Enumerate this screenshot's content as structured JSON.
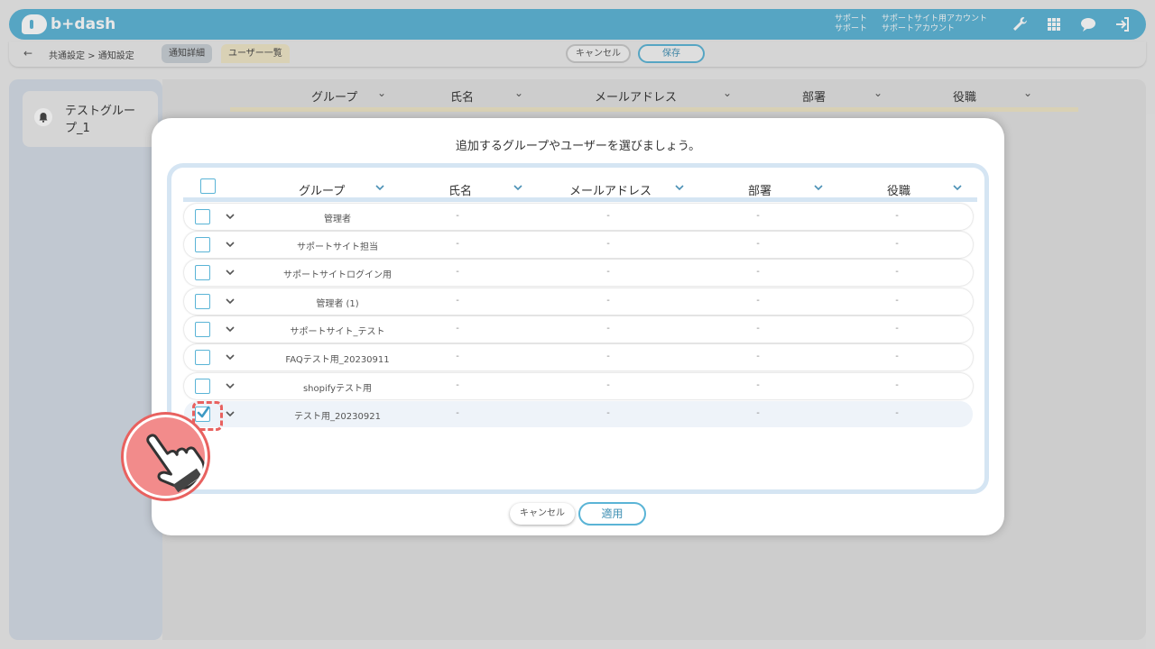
{
  "app": {
    "brand": "b+dash"
  },
  "header": {
    "user_rows": [
      {
        "label": "サポート",
        "value": "サポートサイト用アカウント"
      },
      {
        "label": "サポート",
        "value": "サポートアカウント"
      }
    ],
    "icons": [
      "wrench-icon",
      "grid-icon",
      "chat-icon",
      "logout-icon"
    ]
  },
  "subbar": {
    "back": "←",
    "breadcrumb": "共通設定 > 通知設定",
    "tabs": [
      {
        "label": "通知詳細"
      },
      {
        "label": "ユーザー一覧"
      }
    ],
    "cancel_label": "キャンセル",
    "save_label": "保存"
  },
  "sidebar": {
    "group_card_label": "テストグループ_1"
  },
  "background_table": {
    "columns": [
      "グループ",
      "氏名",
      "メールアドレス",
      "部署",
      "役職"
    ]
  },
  "modal": {
    "title": "追加するグループやユーザーを選びましょう。",
    "columns": [
      "グループ",
      "氏名",
      "メールアドレス",
      "部署",
      "役職"
    ],
    "rows": [
      {
        "group": "管理者",
        "name": "-",
        "email": "-",
        "dept": "-",
        "role": "-",
        "checked": false
      },
      {
        "group": "サポートサイト担当",
        "name": "-",
        "email": "-",
        "dept": "-",
        "role": "-",
        "checked": false
      },
      {
        "group": "サポートサイトログイン用",
        "name": "-",
        "email": "-",
        "dept": "-",
        "role": "-",
        "checked": false
      },
      {
        "group": "管理者 (1)",
        "name": "-",
        "email": "-",
        "dept": "-",
        "role": "-",
        "checked": false
      },
      {
        "group": "サポートサイト_テスト",
        "name": "-",
        "email": "-",
        "dept": "-",
        "role": "-",
        "checked": false
      },
      {
        "group": "FAQテスト用_20230911",
        "name": "-",
        "email": "-",
        "dept": "-",
        "role": "-",
        "checked": false
      },
      {
        "group": "shopifyテスト用",
        "name": "-",
        "email": "-",
        "dept": "-",
        "role": "-",
        "checked": false
      },
      {
        "group": "テスト用_20230921",
        "name": "-",
        "email": "-",
        "dept": "-",
        "role": "-",
        "checked": true
      }
    ],
    "cancel_label": "キャンセル",
    "apply_label": "適用"
  },
  "colors": {
    "accent": "#5ab4d6",
    "highlight": "#e8615f",
    "frame": "#d5e5f3"
  }
}
